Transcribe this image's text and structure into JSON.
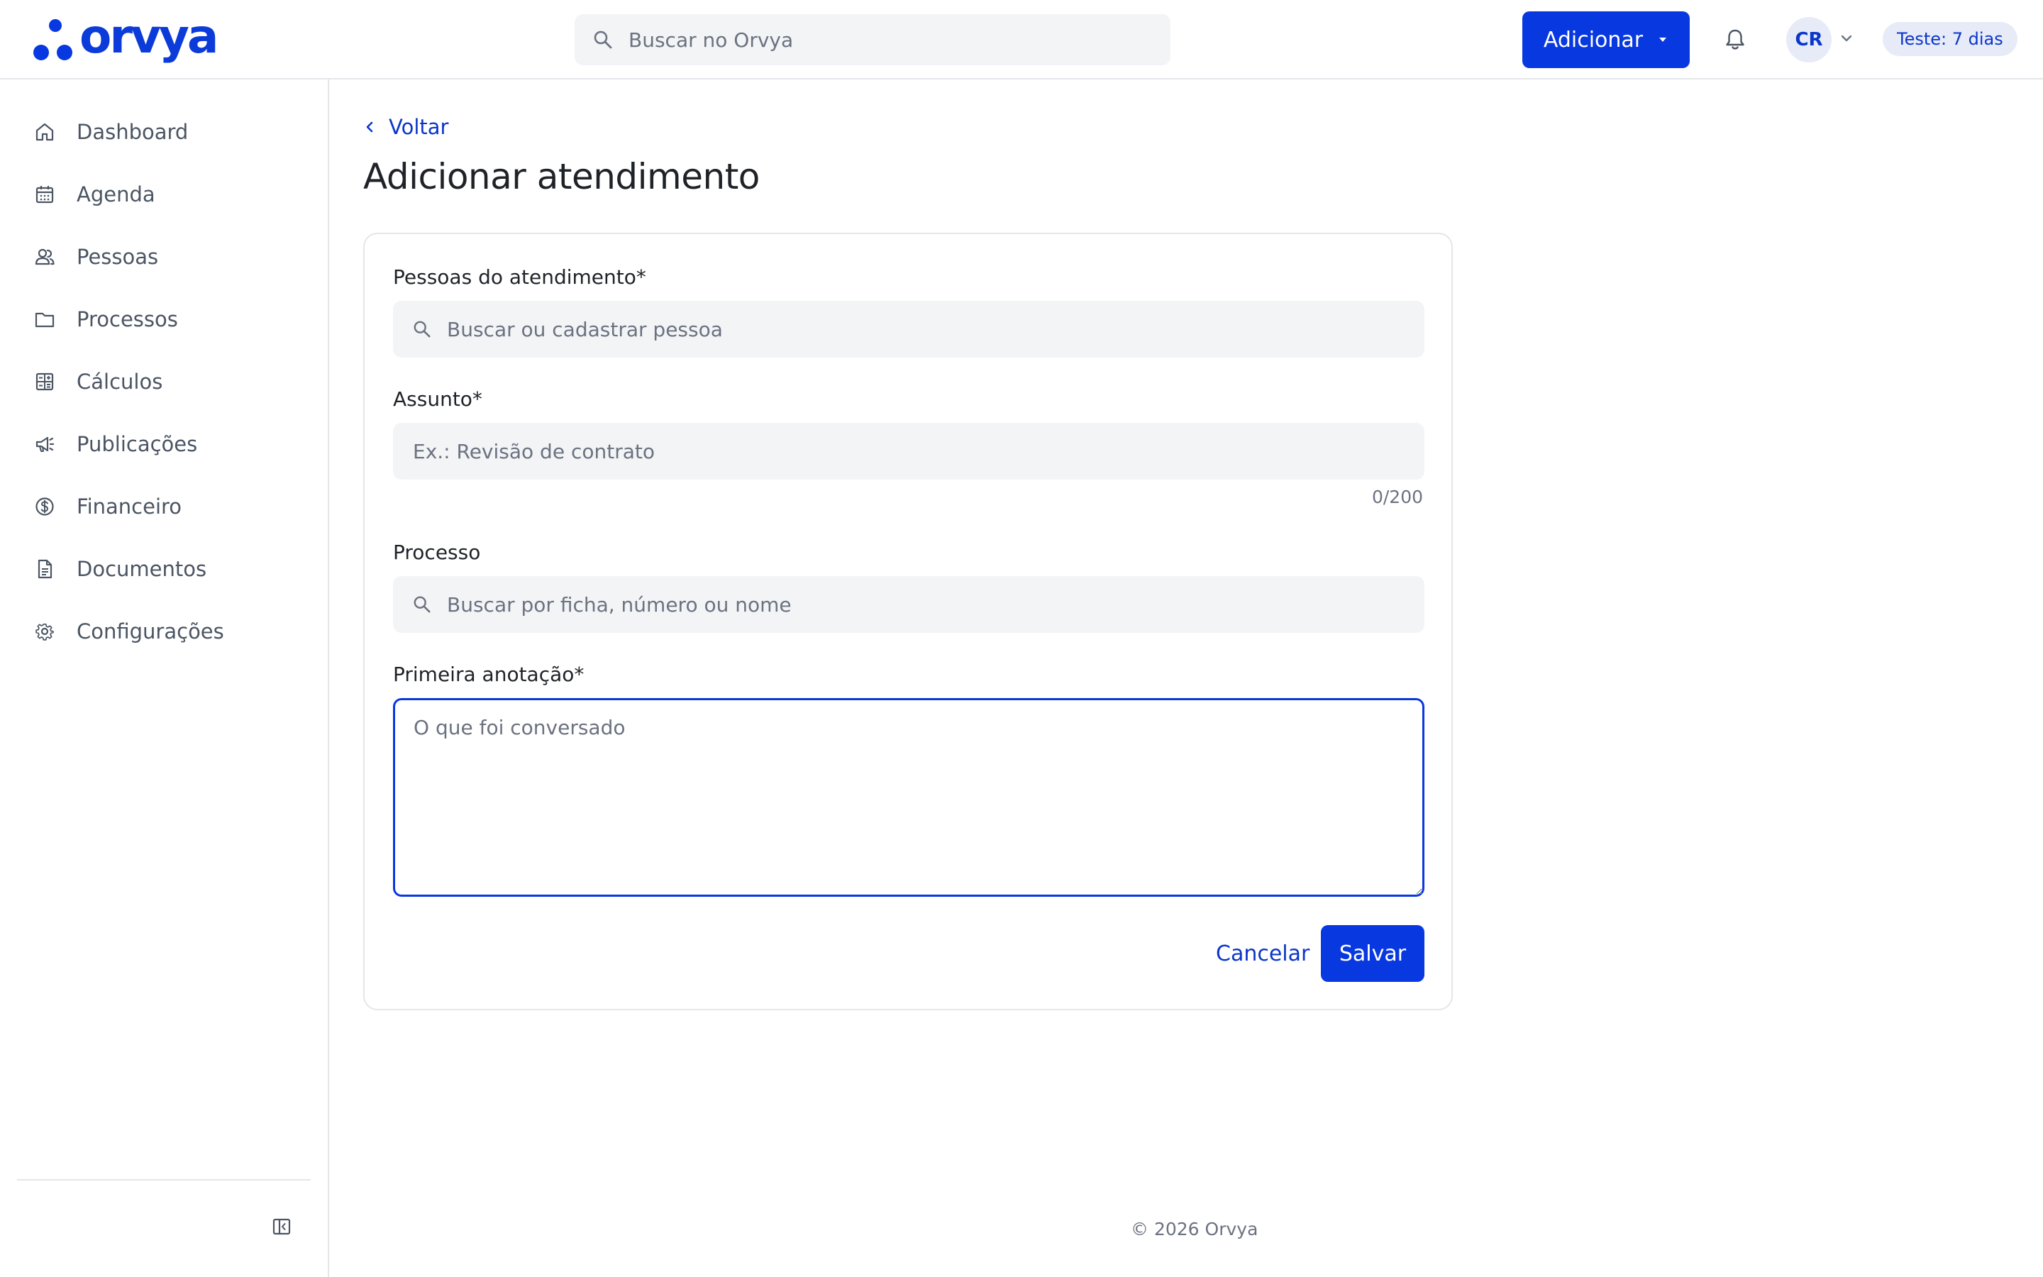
{
  "brand": {
    "name": "orvya",
    "accent": "#0838e0"
  },
  "header": {
    "search_placeholder": "Buscar no Orvya",
    "add_label": "Adicionar",
    "avatar_initials": "CR",
    "trial_badge": "Teste: 7 dias",
    "icons": [
      "search-icon",
      "caret-down-icon",
      "bell-icon",
      "chevron-down-icon"
    ]
  },
  "sidebar": {
    "items": [
      {
        "label": "Dashboard",
        "icon": "home-icon"
      },
      {
        "label": "Agenda",
        "icon": "calendar-icon"
      },
      {
        "label": "Pessoas",
        "icon": "people-icon"
      },
      {
        "label": "Processos",
        "icon": "folder-icon"
      },
      {
        "label": "Cálculos",
        "icon": "calculator-icon"
      },
      {
        "label": "Publicações",
        "icon": "megaphone-icon"
      },
      {
        "label": "Financeiro",
        "icon": "dollar-icon"
      },
      {
        "label": "Documentos",
        "icon": "document-icon"
      },
      {
        "label": "Configurações",
        "icon": "gear-icon"
      }
    ],
    "collapse_icon": "sidebar-collapse-icon"
  },
  "main": {
    "back_label": "Voltar",
    "title": "Adicionar atendimento",
    "form": {
      "people": {
        "label": "Pessoas do atendimento*",
        "placeholder": "Buscar ou cadastrar pessoa",
        "value": ""
      },
      "subject": {
        "label": "Assunto*",
        "placeholder": "Ex.: Revisão de contrato",
        "value": "",
        "counter": "0/200"
      },
      "process": {
        "label": "Processo",
        "placeholder": "Buscar por ficha, número ou nome",
        "value": ""
      },
      "note": {
        "label": "Primeira anotação*",
        "placeholder": "O que foi conversado",
        "value": ""
      },
      "cancel_label": "Cancelar",
      "save_label": "Salvar"
    }
  },
  "footer": {
    "text": "© 2026 Orvya"
  }
}
